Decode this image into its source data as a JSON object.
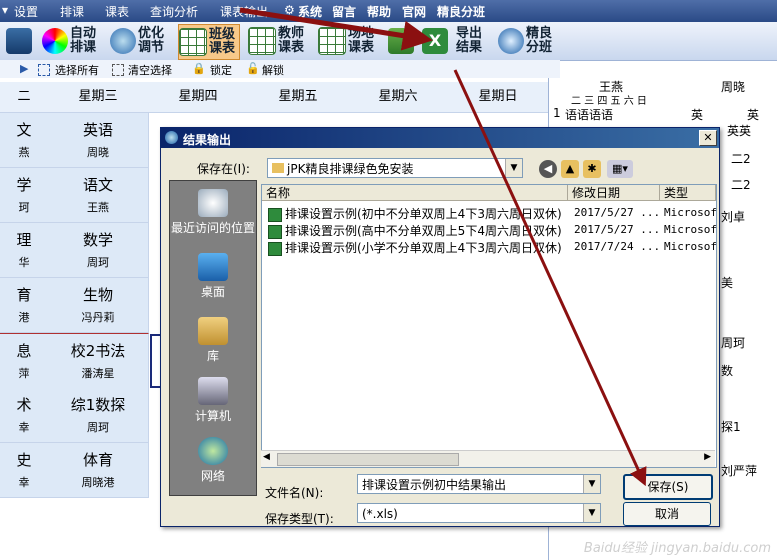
{
  "menu": [
    "设置",
    "排课",
    "课表",
    "查询分析",
    "课表输出",
    "系统",
    "留言",
    "帮助",
    "官网",
    "精良分班"
  ],
  "toolbar": {
    "auto": "自动排课",
    "optimize": "优化调节",
    "class": "班级课表",
    "teacher": "教师课表",
    "room": "场地课表",
    "export": "导出结果",
    "jingliang": "精良分班"
  },
  "subbar": [
    "选择所有",
    "清空选择",
    "锁定",
    "解锁"
  ],
  "timetable": {
    "headers": [
      "二",
      "星期三",
      "星期四",
      "星期五",
      "星期六",
      "星期日"
    ],
    "rows": [
      {
        "c1": "文",
        "t1": "燕",
        "c2": "英语",
        "t2": "周晓"
      },
      {
        "c1": "学",
        "t1": "珂",
        "c2": "语文",
        "t2": "王燕"
      },
      {
        "c1": "理",
        "t1": "华",
        "c2": "数学",
        "t2": "周珂"
      },
      {
        "c1": "育",
        "t1": "港",
        "c2": "生物",
        "t2": "冯丹莉"
      },
      {
        "c1": "息",
        "t1": "萍",
        "c2": "校2书法",
        "t2": "潘涛星"
      },
      {
        "c1": "术",
        "t1": "幸",
        "c2": "综1数探",
        "t2": "周珂"
      },
      {
        "c1": "史",
        "t1": "幸",
        "c2": "体育",
        "t2": "周晓港"
      }
    ]
  },
  "right_panel": {
    "teacher1": "王燕",
    "teacher2": "周晓",
    "days_header": "二 三 四 五 六 日",
    "row1_num": "1",
    "row1": "语语语语",
    "r_ying1": "英",
    "r_ying2": "英",
    "r_yingying": "英英",
    "r_er1": "二2",
    "r_er2": "二2",
    "r_liuzhuo": "刘卓",
    "r_mei": "美",
    "r_zhouke": "周珂",
    "r_shu": "数",
    "r_liuyanping": "刘严萍",
    "r_tan": "探1"
  },
  "dialog": {
    "title": "结果输出",
    "save_in_label": "保存在(I):",
    "save_in_value": "jPK精良排课绿色免安装",
    "places": [
      "最近访问的位置",
      "桌面",
      "库",
      "计算机",
      "网络"
    ],
    "columns": [
      "名称",
      "修改日期",
      "类型"
    ],
    "files": [
      {
        "name": "排课设置示例(初中不分单双周上4下3周六周日双休)",
        "date": "2017/5/27 ...",
        "type": "Microsof"
      },
      {
        "name": "排课设置示例(高中不分单双周上5下4周六周日双休)",
        "date": "2017/5/27 ...",
        "type": "Microsof"
      },
      {
        "name": "排课设置示例(小学不分单双周上4下3周六周日双休)",
        "date": "2017/7/24 ...",
        "type": "Microsof"
      }
    ],
    "filename_label": "文件名(N):",
    "filename_value": "排课设置示例初中结果输出",
    "filetype_label": "保存类型(T):",
    "filetype_value": "(*.xls)",
    "save_button": "保存(S)",
    "cancel_button": "取消"
  },
  "watermark": "Baidu经验 jingyan.baidu.com"
}
